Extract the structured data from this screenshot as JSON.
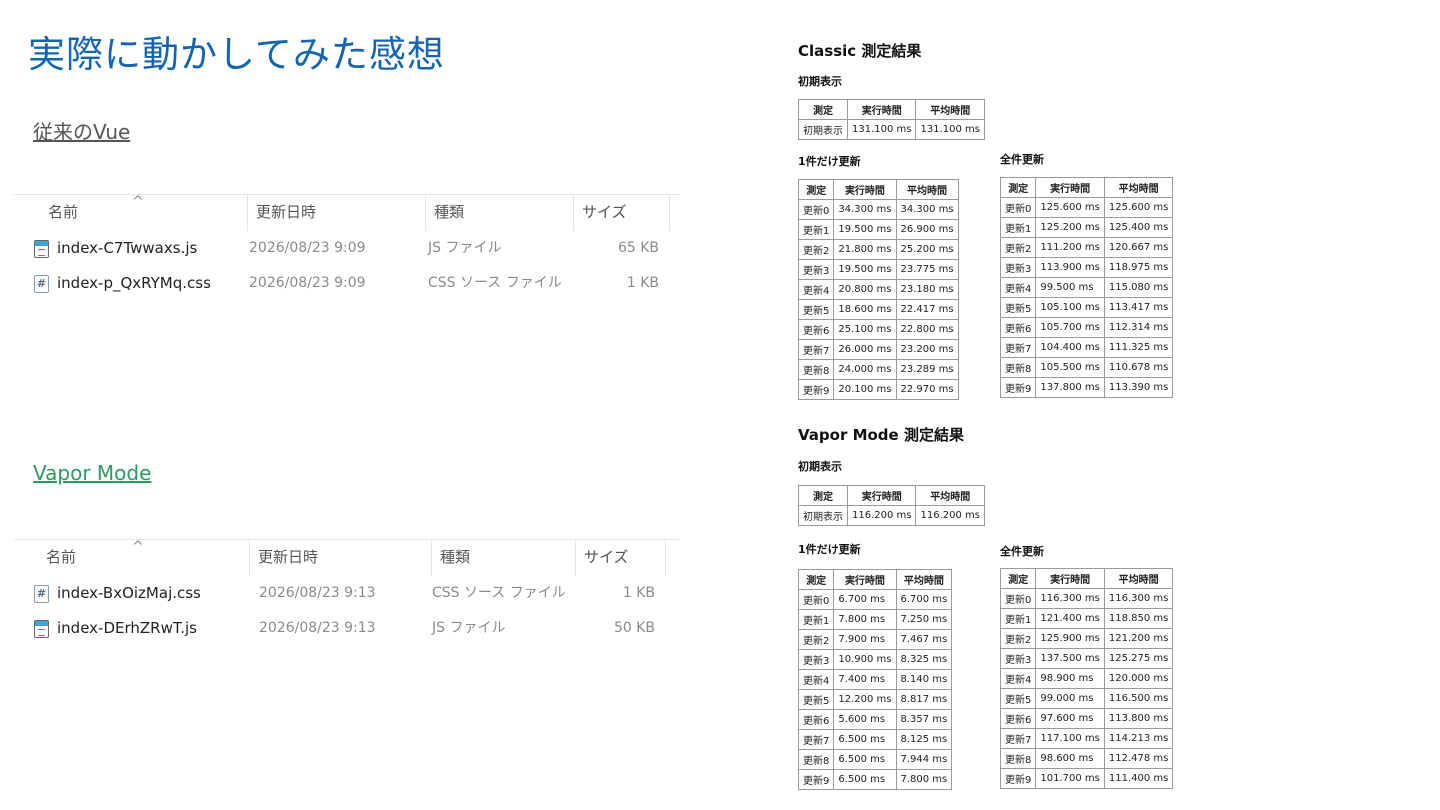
{
  "slide": {
    "title": "実際に動かしてみた感想"
  },
  "classic_explorer": {
    "link": "従来のVue",
    "columns": [
      "名前",
      "更新日時",
      "種類",
      "サイズ"
    ],
    "files": [
      {
        "icon": "js-file-icon",
        "name": "index-C7Twwaxs.js",
        "date": "2026/08/23 9:09",
        "type": "JS ファイル",
        "size": "65 KB"
      },
      {
        "icon": "css-file-icon",
        "name": "index-p_QxRYMq.css",
        "date": "2026/08/23 9:09",
        "type": "CSS ソース ファイル",
        "size": "1 KB"
      }
    ]
  },
  "vapor_explorer": {
    "link": "Vapor Mode",
    "columns": [
      "名前",
      "更新日時",
      "種類",
      "サイズ"
    ],
    "files": [
      {
        "icon": "css-file-icon",
        "name": "index-BxOizMaj.css",
        "date": "2026/08/23 9:13",
        "type": "CSS ソース ファイル",
        "size": "1 KB"
      },
      {
        "icon": "js-file-icon",
        "name": "index-DErhZRwT.js",
        "date": "2026/08/23 9:13",
        "type": "JS ファイル",
        "size": "50 KB"
      }
    ]
  },
  "results": {
    "headers": [
      "測定",
      "実行時間",
      "平均時間"
    ],
    "classic": {
      "title": "Classic 測定結果",
      "initial_label": "初期表示",
      "initial": [
        [
          "初期表示",
          "131.100 ms",
          "131.100 ms"
        ]
      ],
      "single_label": "1件だけ更新",
      "single": [
        [
          "更新0",
          "34.300 ms",
          "34.300 ms"
        ],
        [
          "更新1",
          "19.500 ms",
          "26.900 ms"
        ],
        [
          "更新2",
          "21.800 ms",
          "25.200 ms"
        ],
        [
          "更新3",
          "19.500 ms",
          "23.775 ms"
        ],
        [
          "更新4",
          "20.800 ms",
          "23.180 ms"
        ],
        [
          "更新5",
          "18.600 ms",
          "22.417 ms"
        ],
        [
          "更新6",
          "25.100 ms",
          "22.800 ms"
        ],
        [
          "更新7",
          "26.000 ms",
          "23.200 ms"
        ],
        [
          "更新8",
          "24.000 ms",
          "23.289 ms"
        ],
        [
          "更新9",
          "20.100 ms",
          "22.970 ms"
        ]
      ],
      "all_label": "全件更新",
      "all": [
        [
          "更新0",
          "125.600 ms",
          "125.600 ms"
        ],
        [
          "更新1",
          "125.200 ms",
          "125.400 ms"
        ],
        [
          "更新2",
          "111.200 ms",
          "120.667 ms"
        ],
        [
          "更新3",
          "113.900 ms",
          "118.975 ms"
        ],
        [
          "更新4",
          "99.500 ms",
          "115.080 ms"
        ],
        [
          "更新5",
          "105.100 ms",
          "113.417 ms"
        ],
        [
          "更新6",
          "105.700 ms",
          "112.314 ms"
        ],
        [
          "更新7",
          "104.400 ms",
          "111.325 ms"
        ],
        [
          "更新8",
          "105.500 ms",
          "110.678 ms"
        ],
        [
          "更新9",
          "137.800 ms",
          "113.390 ms"
        ]
      ]
    },
    "vapor": {
      "title": "Vapor Mode 測定結果",
      "initial_label": "初期表示",
      "initial": [
        [
          "初期表示",
          "116.200 ms",
          "116.200 ms"
        ]
      ],
      "single_label": "1件だけ更新",
      "single": [
        [
          "更新0",
          "6.700 ms",
          "6.700 ms"
        ],
        [
          "更新1",
          "7.800 ms",
          "7.250 ms"
        ],
        [
          "更新2",
          "7.900 ms",
          "7.467 ms"
        ],
        [
          "更新3",
          "10.900 ms",
          "8.325 ms"
        ],
        [
          "更新4",
          "7.400 ms",
          "8.140 ms"
        ],
        [
          "更新5",
          "12.200 ms",
          "8.817 ms"
        ],
        [
          "更新6",
          "5.600 ms",
          "8.357 ms"
        ],
        [
          "更新7",
          "6.500 ms",
          "8.125 ms"
        ],
        [
          "更新8",
          "6.500 ms",
          "7.944 ms"
        ],
        [
          "更新9",
          "6.500 ms",
          "7.800 ms"
        ]
      ],
      "all_label": "全件更新",
      "all": [
        [
          "更新0",
          "116.300 ms",
          "116.300 ms"
        ],
        [
          "更新1",
          "121.400 ms",
          "118.850 ms"
        ],
        [
          "更新2",
          "125.900 ms",
          "121.200 ms"
        ],
        [
          "更新3",
          "137.500 ms",
          "125.275 ms"
        ],
        [
          "更新4",
          "98.900 ms",
          "120.000 ms"
        ],
        [
          "更新5",
          "99.000 ms",
          "116.500 ms"
        ],
        [
          "更新6",
          "97.600 ms",
          "113.800 ms"
        ],
        [
          "更新7",
          "117.100 ms",
          "114.213 ms"
        ],
        [
          "更新8",
          "98.600 ms",
          "112.478 ms"
        ],
        [
          "更新9",
          "101.700 ms",
          "111.400 ms"
        ]
      ]
    }
  }
}
